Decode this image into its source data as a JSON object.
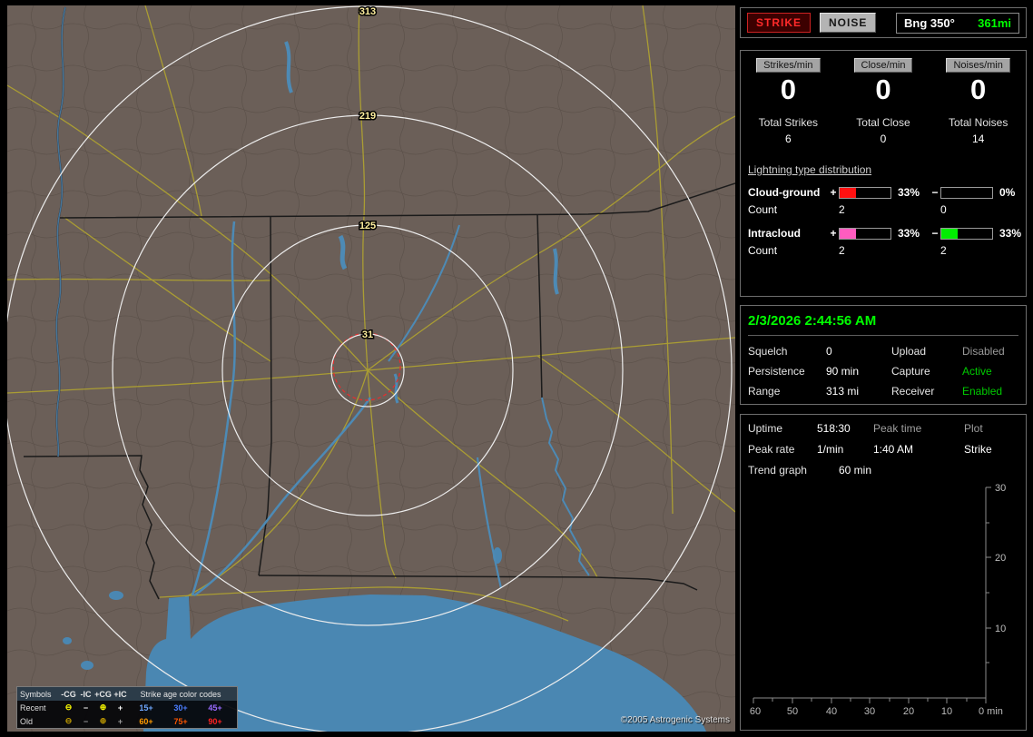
{
  "colors": {
    "green": "#00ff00"
  },
  "map": {
    "range_labels": {
      "r313": "313",
      "r219": "219",
      "r125": "125",
      "r31": "31"
    },
    "copyright": "©2005 Astrogenic Systems",
    "legend": {
      "symbols_header": "Symbols",
      "columns": [
        "-CG",
        "-IC",
        "+CG",
        "+IC"
      ],
      "age_title": "Strike age color codes",
      "recent_label": "Recent",
      "old_label": "Old",
      "recent_symbols": [
        "⊖",
        "−",
        "⊕",
        "+"
      ],
      "old_symbols": [
        "⊖",
        "−",
        "⊕",
        "+"
      ],
      "recent_ages": [
        "15+",
        "30+",
        "45+"
      ],
      "old_ages": [
        "60+",
        "75+",
        "90+"
      ],
      "recent_age_colors": [
        "#6fa8ff",
        "#4a7dff",
        "#9a6bff"
      ],
      "old_age_colors": [
        "#ff9a00",
        "#ff5500",
        "#ff2222"
      ]
    }
  },
  "toolbar": {
    "strike": "STRIKE",
    "noise": "NOISE",
    "bearing_label": "Bng 350°",
    "bearing_value": "361mi"
  },
  "rates": {
    "headers": [
      "Strikes/min",
      "Close/min",
      "Noises/min"
    ],
    "values": [
      "0",
      "0",
      "0"
    ],
    "total_labels": [
      "Total Strikes",
      "Total Close",
      "Total Noises"
    ],
    "total_values": [
      "6",
      "0",
      "14"
    ]
  },
  "distribution": {
    "title": "Lightning type distribution",
    "rows": [
      {
        "label": "Cloud-ground",
        "plus_pct": "33%",
        "plus_fill": "33%",
        "plus_color": "#ff1111",
        "minus_pct": "0%",
        "minus_fill": "0%",
        "minus_color": "#00ee00",
        "count_label": "Count",
        "plus_count": "2",
        "minus_count": "0"
      },
      {
        "label": "Intracloud",
        "plus_pct": "33%",
        "plus_fill": "33%",
        "plus_color": "#ff5cc0",
        "minus_pct": "33%",
        "minus_fill": "33%",
        "minus_color": "#00ee00",
        "count_label": "Count",
        "plus_count": "2",
        "minus_count": "2"
      }
    ]
  },
  "status": {
    "datetime": "2/3/2026 2:44:56 AM",
    "rows": [
      {
        "label1": "Squelch",
        "value1": "0",
        "label2": "Upload",
        "value2": "Disabled",
        "value2_color": "#9a9a9a"
      },
      {
        "label1": "Persistence",
        "value1": "90 min",
        "label2": "Capture",
        "value2": "Active",
        "value2_color": "#00cc00"
      },
      {
        "label1": "Range",
        "value1": "313 mi",
        "label2": "Receiver",
        "value2": "Enabled",
        "value2_color": "#00cc00"
      }
    ]
  },
  "uptime_panel": {
    "uptime_label": "Uptime",
    "uptime_value": "518:30",
    "peak_time_label": "Peak time",
    "peak_time_value": "1:40 AM",
    "plot_label": "Plot",
    "plot_value": "Strike",
    "peak_rate_label": "Peak rate",
    "peak_rate_value": "1/min",
    "trend_label": "Trend graph",
    "trend_value": "60 min"
  },
  "trend_graph": {
    "y_ticks": [
      "30",
      "20",
      "10"
    ],
    "x_ticks": [
      "60",
      "50",
      "40",
      "30",
      "20",
      "10"
    ],
    "x_end": "0 min"
  }
}
